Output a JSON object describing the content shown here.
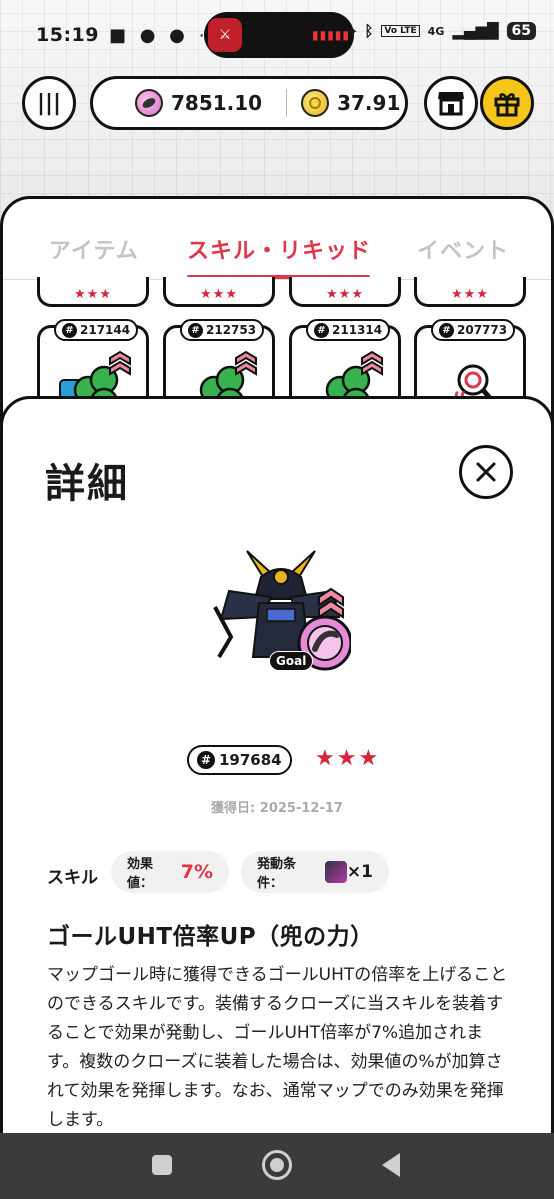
{
  "status_bar": {
    "time": "15:19",
    "left_glyphs": "■ ● ● ⋯",
    "network": "4G",
    "volte": "Vo LTE",
    "battery": "65"
  },
  "header": {
    "liquid_amount": "7851.10",
    "token_amount": "37.91"
  },
  "tabs": [
    {
      "label": "アイテム"
    },
    {
      "label": "スキル・リキッド",
      "active": true
    },
    {
      "label": "イベント"
    }
  ],
  "grid_top_row": [
    {
      "stars": "★★★"
    },
    {
      "stars": "★★★"
    },
    {
      "stars": "★★★"
    },
    {
      "stars": "★★★"
    }
  ],
  "grid_cards": [
    {
      "id": "217144"
    },
    {
      "id": "212753"
    },
    {
      "id": "211314"
    },
    {
      "id": "207773"
    }
  ],
  "detail": {
    "title": "詳細",
    "goal_tag": "Goal",
    "id": "197684",
    "stars": "★★★",
    "acquired": "獲得日: 2025-12-17",
    "skill_label": "スキル",
    "effect_label": "効果値：",
    "effect_value": "7%",
    "condition_label": "発動条件：",
    "condition_count": "×1",
    "skill_name": "ゴールUHT倍率UP（兜の力）",
    "description": "マップゴール時に獲得できるゴールUHTの倍率を上げることのできるスキルです。装備するクローズに当スキルを装着することで効果が発動し、ゴールUHT倍率が7%追加されます。複数のクローズに装着した場合は、効果値の%が加算されて効果を発揮します。なお、通常マップでのみ効果を発揮します。"
  },
  "colors": {
    "accent": "#e0364a",
    "gift": "#f6c51a",
    "nav": "#3b3b3b"
  },
  "icons": [
    "menu-icon",
    "liquid-coin-icon",
    "gold-coin-icon",
    "shop-icon",
    "gift-icon",
    "close-icon",
    "hash-icon",
    "samurai-helmet-icon"
  ]
}
